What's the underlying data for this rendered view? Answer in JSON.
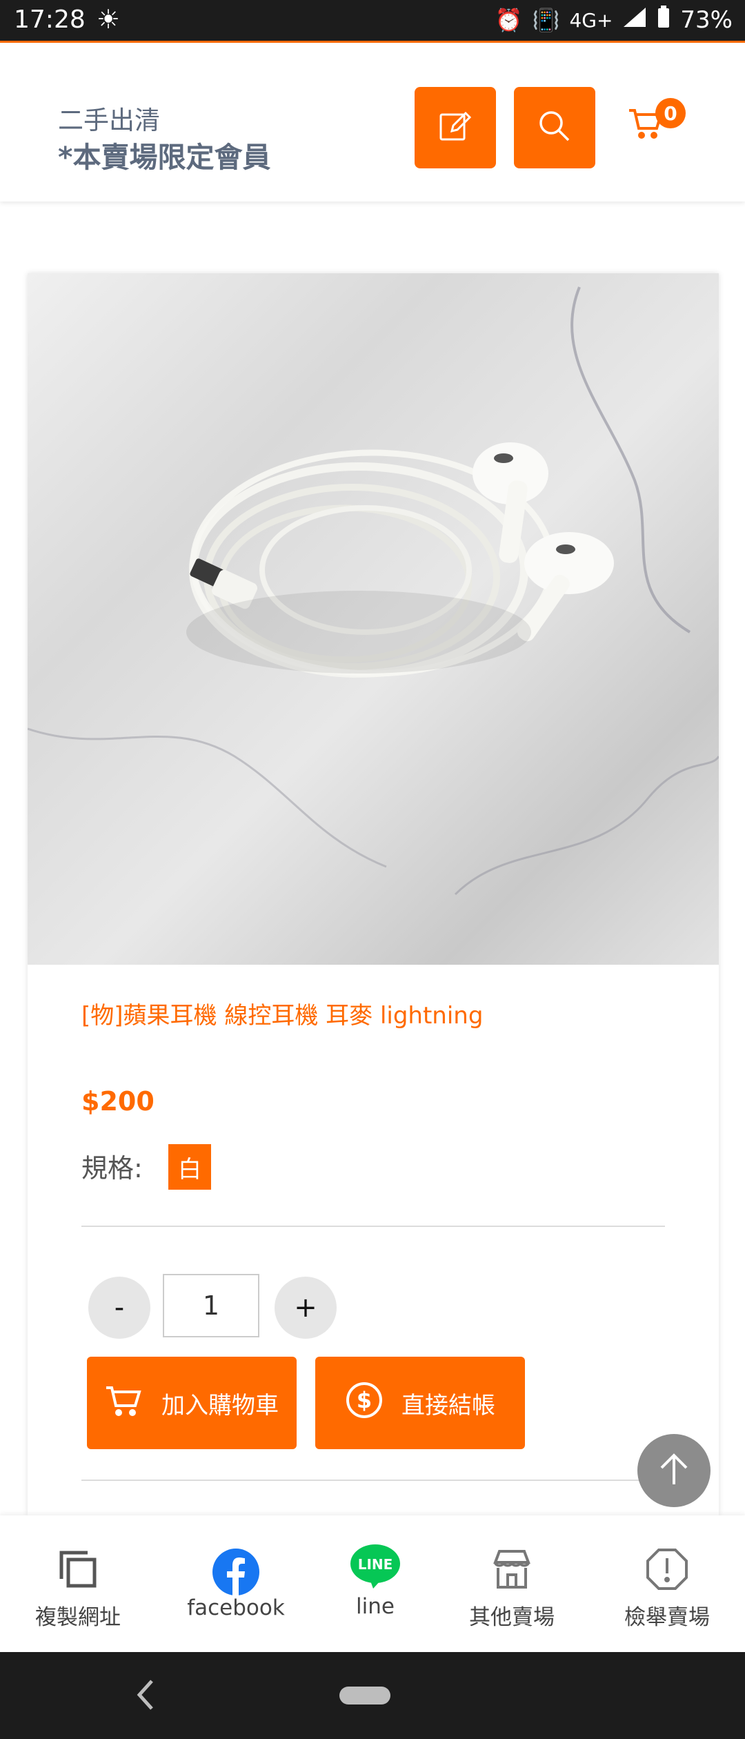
{
  "status_bar": {
    "time": "17:28",
    "network": "4G+",
    "battery": "73%",
    "icons": [
      "brightness-icon",
      "alarm-icon",
      "vibrate-icon",
      "signal-icon",
      "battery-icon"
    ]
  },
  "header": {
    "subtitle": "二手出清",
    "title": "*本賣場限定會員",
    "cart_count": "0",
    "icons": [
      "edit-icon",
      "search-icon",
      "cart-icon"
    ]
  },
  "product": {
    "title": "[物]蘋果耳機 線控耳機 耳麥 lightning",
    "price": "$200",
    "spec_label": "規格:",
    "spec_option": "白",
    "quantity": "1",
    "minus_label": "-",
    "plus_label": "+",
    "add_to_cart": "加入購物車",
    "checkout": "直接結帳"
  },
  "bottom_nav": [
    {
      "label": "複製網址",
      "icon": "copy-icon"
    },
    {
      "label": "facebook",
      "icon": "facebook-icon"
    },
    {
      "label": "line",
      "icon": "line-icon"
    },
    {
      "label": "其他賣場",
      "icon": "store-icon"
    },
    {
      "label": "檢舉賣場",
      "icon": "report-icon"
    }
  ],
  "colors": {
    "accent": "#ff6a00",
    "header_text": "#5d6a7e",
    "facebook": "#1877f2",
    "line": "#06c755"
  }
}
